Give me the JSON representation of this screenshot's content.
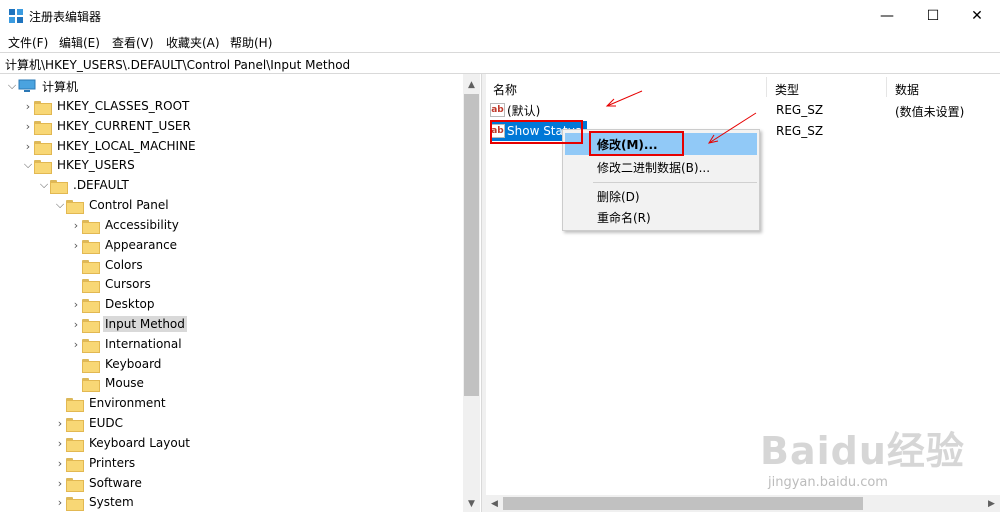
{
  "window": {
    "title": "注册表编辑器",
    "minimize": "—",
    "maximize": "☐",
    "close": "✕"
  },
  "menu": [
    "文件(F)",
    "编辑(E)",
    "查看(V)",
    "收藏夹(A)",
    "帮助(H)"
  ],
  "address": "计算机\\HKEY_USERS\\.DEFAULT\\Control Panel\\Input Method",
  "tree": {
    "root": "计算机",
    "hives": [
      "HKEY_CLASSES_ROOT",
      "HKEY_CURRENT_USER",
      "HKEY_LOCAL_MACHINE",
      "HKEY_USERS"
    ],
    "default_key": ".DEFAULT",
    "control_panel": "Control Panel",
    "control_panel_children": [
      "Accessibility",
      "Appearance",
      "Colors",
      "Cursors",
      "Desktop",
      "Input Method",
      "International",
      "Keyboard",
      "Mouse"
    ],
    "default_children": [
      "Environment",
      "EUDC",
      "Keyboard Layout",
      "Printers",
      "Software",
      "System"
    ],
    "selected": "Input Method"
  },
  "list": {
    "headers": {
      "name": "名称",
      "type": "类型",
      "data": "数据"
    },
    "rows": [
      {
        "name": "(默认)",
        "type": "REG_SZ",
        "data": "(数值未设置)"
      },
      {
        "name": "Show Status",
        "type": "REG_SZ",
        "data": ""
      }
    ]
  },
  "context_menu": {
    "items": [
      "修改(M)...",
      "修改二进制数据(B)...",
      "删除(D)",
      "重命名(R)"
    ],
    "highlighted": "修改(M)..."
  },
  "icons": {
    "app": "regedit-icon",
    "computer": "computer-icon",
    "folder": "folder-icon",
    "string_value": "string-value-icon",
    "expand": "chevron-right-icon",
    "collapse": "chevron-down-icon"
  },
  "colors": {
    "selection": "#91c9f7",
    "highlight_box": "#e60000",
    "folder": "#f8d775"
  },
  "watermark": {
    "brand": "Baidu经验",
    "url": "jingyan.baidu.com"
  }
}
